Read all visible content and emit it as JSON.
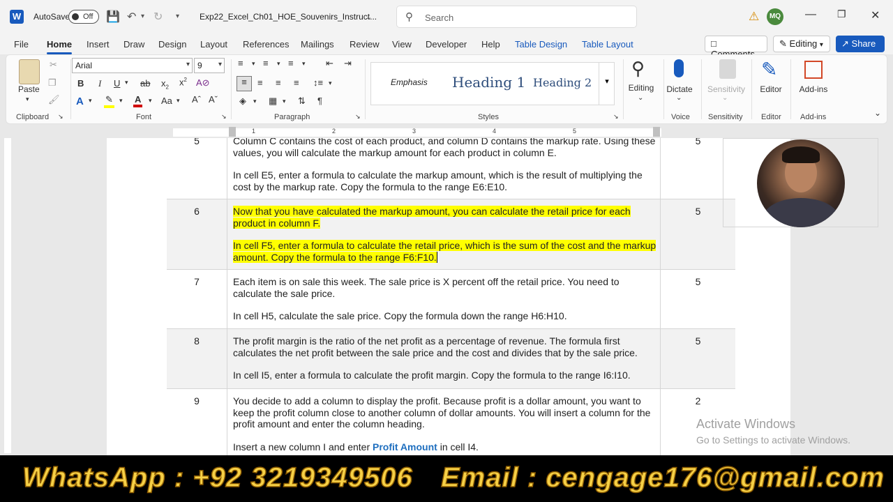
{
  "titlebar": {
    "autosave_label": "AutoSave",
    "autosave_state": "Off",
    "doc_title": "Exp22_Excel_Ch01_HOE_Souvenirs_Instruct...",
    "search_placeholder": "Search",
    "user_initials": "MQ"
  },
  "menu": {
    "tabs": [
      "File",
      "Home",
      "Insert",
      "Draw",
      "Design",
      "Layout",
      "References",
      "Mailings",
      "Review",
      "View",
      "Developer",
      "Help",
      "Table Design",
      "Table Layout"
    ],
    "comments": "Comments",
    "editing": "Editing",
    "share": "Share"
  },
  "ribbon": {
    "paste": "Paste",
    "font_name": "Arial",
    "font_size": "9",
    "groups": {
      "clipboard": "Clipboard",
      "font": "Font",
      "paragraph": "Paragraph",
      "styles": "Styles",
      "voice": "Voice",
      "sensitivity": "Sensitivity",
      "editor": "Editor",
      "addins": "Add-ins"
    },
    "styles": {
      "emphasis": "Emphasis",
      "heading1": "Heading 1",
      "heading2": "Heading 2"
    },
    "big_buttons": {
      "editing": "Editing",
      "dictate": "Dictate",
      "sensitivity": "Sensitivity",
      "editor": "Editor",
      "addins": "Add-ins"
    }
  },
  "ruler": {
    "numbers": [
      "1",
      "2",
      "3",
      "4",
      "5",
      "6"
    ]
  },
  "table": {
    "row5": {
      "num": "5",
      "p1": "Column C contains the cost of each product, and column D contains the markup rate. Using these values, you will calculate the markup amount for each product in column E.",
      "p2": "In cell E5, enter a formula to calculate the markup amount, which is the result of multiplying the cost by the markup rate. Copy the formula to the range E6:E10.",
      "pts": "5"
    },
    "row6": {
      "num": "6",
      "p1": "Now that you have calculated the markup amount, you can calculate the retail price for each product in column F.",
      "p2": "In cell F5, enter a formula to calculate the retail price, which is the sum of the cost and the markup amount. Copy the formula to the range F6:F10.",
      "pts": "5"
    },
    "row7": {
      "num": "7",
      "p1": "Each item is on sale this week. The sale price is X percent off the retail price. You need to calculate the sale price.",
      "p2": "In cell H5, calculate the sale price. Copy the formula down the range H6:H10.",
      "pts": "5"
    },
    "row8": {
      "num": "8",
      "p1": "The profit margin is the ratio of the net profit as a percentage of revenue. The formula first calculates the net profit between the sale price and the cost and divides that by the sale price.",
      "p2": "In cell I5, enter a formula to calculate the profit margin. Copy the formula to the range I6:I10.",
      "pts": "5"
    },
    "row9": {
      "num": "9",
      "p1": "You decide to add a column to display the profit. Because profit is a dollar amount, you want to keep the profit column close to another column of dollar amounts. You will insert a column for the profit amount and enter the column heading.",
      "p2_pre": "Insert a new column I and enter ",
      "p2_bold": "Profit Amount",
      "p2_post": " in cell I4.",
      "pts": "2"
    }
  },
  "watermark": {
    "line1": "Activate Windows",
    "line2": "Go to Settings to activate Windows."
  },
  "footer": {
    "whatsapp": "WhatsApp  : +92 3219349506",
    "email": "Email  :  cengage176@gmail.com"
  }
}
